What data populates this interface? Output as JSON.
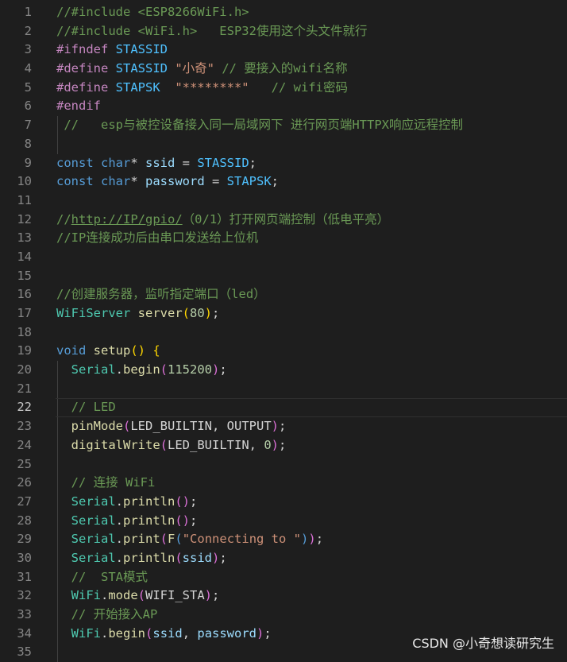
{
  "editor": {
    "active_line": 22,
    "lines": [
      {
        "n": "1",
        "tokens": [
          {
            "t": "//#include <ESP8266WiFi.h>",
            "c": "comment"
          }
        ]
      },
      {
        "n": "2",
        "tokens": [
          {
            "t": "//#include <WiFi.h>   ESP32使用这个头文件就行",
            "c": "comment"
          }
        ]
      },
      {
        "n": "3",
        "tokens": [
          {
            "t": "#ifndef ",
            "c": "directive"
          },
          {
            "t": "STASSID",
            "c": "macro"
          }
        ]
      },
      {
        "n": "4",
        "tokens": [
          {
            "t": "#define ",
            "c": "directive"
          },
          {
            "t": "STASSID ",
            "c": "macro"
          },
          {
            "t": "\"小奇\"",
            "c": "string"
          },
          {
            "t": " // 要接入的wifi名称",
            "c": "comment"
          }
        ]
      },
      {
        "n": "5",
        "tokens": [
          {
            "t": "#define ",
            "c": "directive"
          },
          {
            "t": "STAPSK  ",
            "c": "macro"
          },
          {
            "t": "\"********\"",
            "c": "string"
          },
          {
            "t": "   // wifi密码",
            "c": "comment"
          }
        ]
      },
      {
        "n": "6",
        "tokens": [
          {
            "t": "#endif",
            "c": "directive"
          }
        ]
      },
      {
        "n": "7",
        "guide": true,
        "tokens": [
          {
            "t": " //   esp与被控设备接入同一局域网下 进行网页端HTTPX响应远程控制",
            "c": "comment"
          }
        ]
      },
      {
        "n": "8",
        "guide": true,
        "tokens": []
      },
      {
        "n": "9",
        "tokens": [
          {
            "t": "const ",
            "c": "keyword"
          },
          {
            "t": "char",
            "c": "keyword"
          },
          {
            "t": "* ",
            "c": "punct"
          },
          {
            "t": "ssid",
            "c": "var"
          },
          {
            "t": " = ",
            "c": "punct"
          },
          {
            "t": "STASSID",
            "c": "macro"
          },
          {
            "t": ";",
            "c": "punct"
          }
        ]
      },
      {
        "n": "10",
        "tokens": [
          {
            "t": "const ",
            "c": "keyword"
          },
          {
            "t": "char",
            "c": "keyword"
          },
          {
            "t": "* ",
            "c": "punct"
          },
          {
            "t": "password",
            "c": "var"
          },
          {
            "t": " = ",
            "c": "punct"
          },
          {
            "t": "STAPSK",
            "c": "macro"
          },
          {
            "t": ";",
            "c": "punct"
          }
        ]
      },
      {
        "n": "11",
        "tokens": []
      },
      {
        "n": "12",
        "tokens": [
          {
            "t": "//",
            "c": "comment"
          },
          {
            "t": "http://IP/gpio/",
            "c": "link"
          },
          {
            "t": "（0/1）打开网页端控制（低电平亮）",
            "c": "comment"
          }
        ]
      },
      {
        "n": "13",
        "tokens": [
          {
            "t": "//IP连接成功后由串口发送给上位机",
            "c": "comment"
          }
        ]
      },
      {
        "n": "14",
        "tokens": []
      },
      {
        "n": "15",
        "tokens": []
      },
      {
        "n": "16",
        "tokens": [
          {
            "t": "//创建服务器，监听指定端口（led）",
            "c": "comment"
          }
        ]
      },
      {
        "n": "17",
        "tokens": [
          {
            "t": "WiFiServer ",
            "c": "type"
          },
          {
            "t": "server",
            "c": "fn"
          },
          {
            "t": "(",
            "c": "brace"
          },
          {
            "t": "80",
            "c": "num"
          },
          {
            "t": ")",
            "c": "brace"
          },
          {
            "t": ";",
            "c": "punct"
          }
        ]
      },
      {
        "n": "18",
        "tokens": []
      },
      {
        "n": "19",
        "tokens": [
          {
            "t": "void ",
            "c": "keyword"
          },
          {
            "t": "setup",
            "c": "fn"
          },
          {
            "t": "() {",
            "c": "brace"
          }
        ]
      },
      {
        "n": "20",
        "guide": true,
        "tokens": [
          {
            "t": "  Serial",
            "c": "type"
          },
          {
            "t": ".",
            "c": "punct"
          },
          {
            "t": "begin",
            "c": "fn"
          },
          {
            "t": "(",
            "c": "paren2"
          },
          {
            "t": "115200",
            "c": "num"
          },
          {
            "t": ")",
            "c": "paren2"
          },
          {
            "t": ";",
            "c": "punct"
          }
        ]
      },
      {
        "n": "21",
        "guide": true,
        "tokens": []
      },
      {
        "n": "22",
        "guide": true,
        "tokens": [
          {
            "t": "  // LED",
            "c": "comment"
          }
        ]
      },
      {
        "n": "23",
        "guide": true,
        "tokens": [
          {
            "t": "  pinMode",
            "c": "fn"
          },
          {
            "t": "(",
            "c": "paren2"
          },
          {
            "t": "LED_BUILTIN",
            "c": "punct"
          },
          {
            "t": ", ",
            "c": "punct"
          },
          {
            "t": "OUTPUT",
            "c": "punct"
          },
          {
            "t": ")",
            "c": "paren2"
          },
          {
            "t": ";",
            "c": "punct"
          }
        ]
      },
      {
        "n": "24",
        "guide": true,
        "tokens": [
          {
            "t": "  digitalWrite",
            "c": "fn"
          },
          {
            "t": "(",
            "c": "paren2"
          },
          {
            "t": "LED_BUILTIN",
            "c": "punct"
          },
          {
            "t": ", ",
            "c": "punct"
          },
          {
            "t": "0",
            "c": "num"
          },
          {
            "t": ")",
            "c": "paren2"
          },
          {
            "t": ";",
            "c": "punct"
          }
        ]
      },
      {
        "n": "25",
        "guide": true,
        "tokens": []
      },
      {
        "n": "26",
        "guide": true,
        "tokens": [
          {
            "t": "  // 连接 WiFi",
            "c": "comment"
          }
        ]
      },
      {
        "n": "27",
        "guide": true,
        "tokens": [
          {
            "t": "  Serial",
            "c": "type"
          },
          {
            "t": ".",
            "c": "punct"
          },
          {
            "t": "println",
            "c": "fn"
          },
          {
            "t": "()",
            "c": "paren2"
          },
          {
            "t": ";",
            "c": "punct"
          }
        ]
      },
      {
        "n": "28",
        "guide": true,
        "tokens": [
          {
            "t": "  Serial",
            "c": "type"
          },
          {
            "t": ".",
            "c": "punct"
          },
          {
            "t": "println",
            "c": "fn"
          },
          {
            "t": "()",
            "c": "paren2"
          },
          {
            "t": ";",
            "c": "punct"
          }
        ]
      },
      {
        "n": "29",
        "guide": true,
        "tokens": [
          {
            "t": "  Serial",
            "c": "type"
          },
          {
            "t": ".",
            "c": "punct"
          },
          {
            "t": "print",
            "c": "fn"
          },
          {
            "t": "(",
            "c": "paren2"
          },
          {
            "t": "F",
            "c": "fn"
          },
          {
            "t": "(",
            "c": "keyword"
          },
          {
            "t": "\"Connecting to \"",
            "c": "string"
          },
          {
            "t": ")",
            "c": "keyword"
          },
          {
            "t": ")",
            "c": "paren2"
          },
          {
            "t": ";",
            "c": "punct"
          }
        ]
      },
      {
        "n": "30",
        "guide": true,
        "tokens": [
          {
            "t": "  Serial",
            "c": "type"
          },
          {
            "t": ".",
            "c": "punct"
          },
          {
            "t": "println",
            "c": "fn"
          },
          {
            "t": "(",
            "c": "paren2"
          },
          {
            "t": "ssid",
            "c": "var"
          },
          {
            "t": ")",
            "c": "paren2"
          },
          {
            "t": ";",
            "c": "punct"
          }
        ]
      },
      {
        "n": "31",
        "guide": true,
        "tokens": [
          {
            "t": "  //  STA模式",
            "c": "comment"
          }
        ]
      },
      {
        "n": "32",
        "guide": true,
        "tokens": [
          {
            "t": "  WiFi",
            "c": "type"
          },
          {
            "t": ".",
            "c": "punct"
          },
          {
            "t": "mode",
            "c": "fn"
          },
          {
            "t": "(",
            "c": "paren2"
          },
          {
            "t": "WIFI_STA",
            "c": "punct"
          },
          {
            "t": ")",
            "c": "paren2"
          },
          {
            "t": ";",
            "c": "punct"
          }
        ]
      },
      {
        "n": "33",
        "guide": true,
        "tokens": [
          {
            "t": "  // 开始接入AP",
            "c": "comment"
          }
        ]
      },
      {
        "n": "34",
        "guide": true,
        "tokens": [
          {
            "t": "  WiFi",
            "c": "type"
          },
          {
            "t": ".",
            "c": "punct"
          },
          {
            "t": "begin",
            "c": "fn"
          },
          {
            "t": "(",
            "c": "paren2"
          },
          {
            "t": "ssid",
            "c": "var"
          },
          {
            "t": ", ",
            "c": "punct"
          },
          {
            "t": "password",
            "c": "var"
          },
          {
            "t": ")",
            "c": "paren2"
          },
          {
            "t": ";",
            "c": "punct"
          }
        ]
      },
      {
        "n": "35",
        "guide": true,
        "tokens": []
      }
    ]
  },
  "watermark": "CSDN @小奇想读研究生"
}
